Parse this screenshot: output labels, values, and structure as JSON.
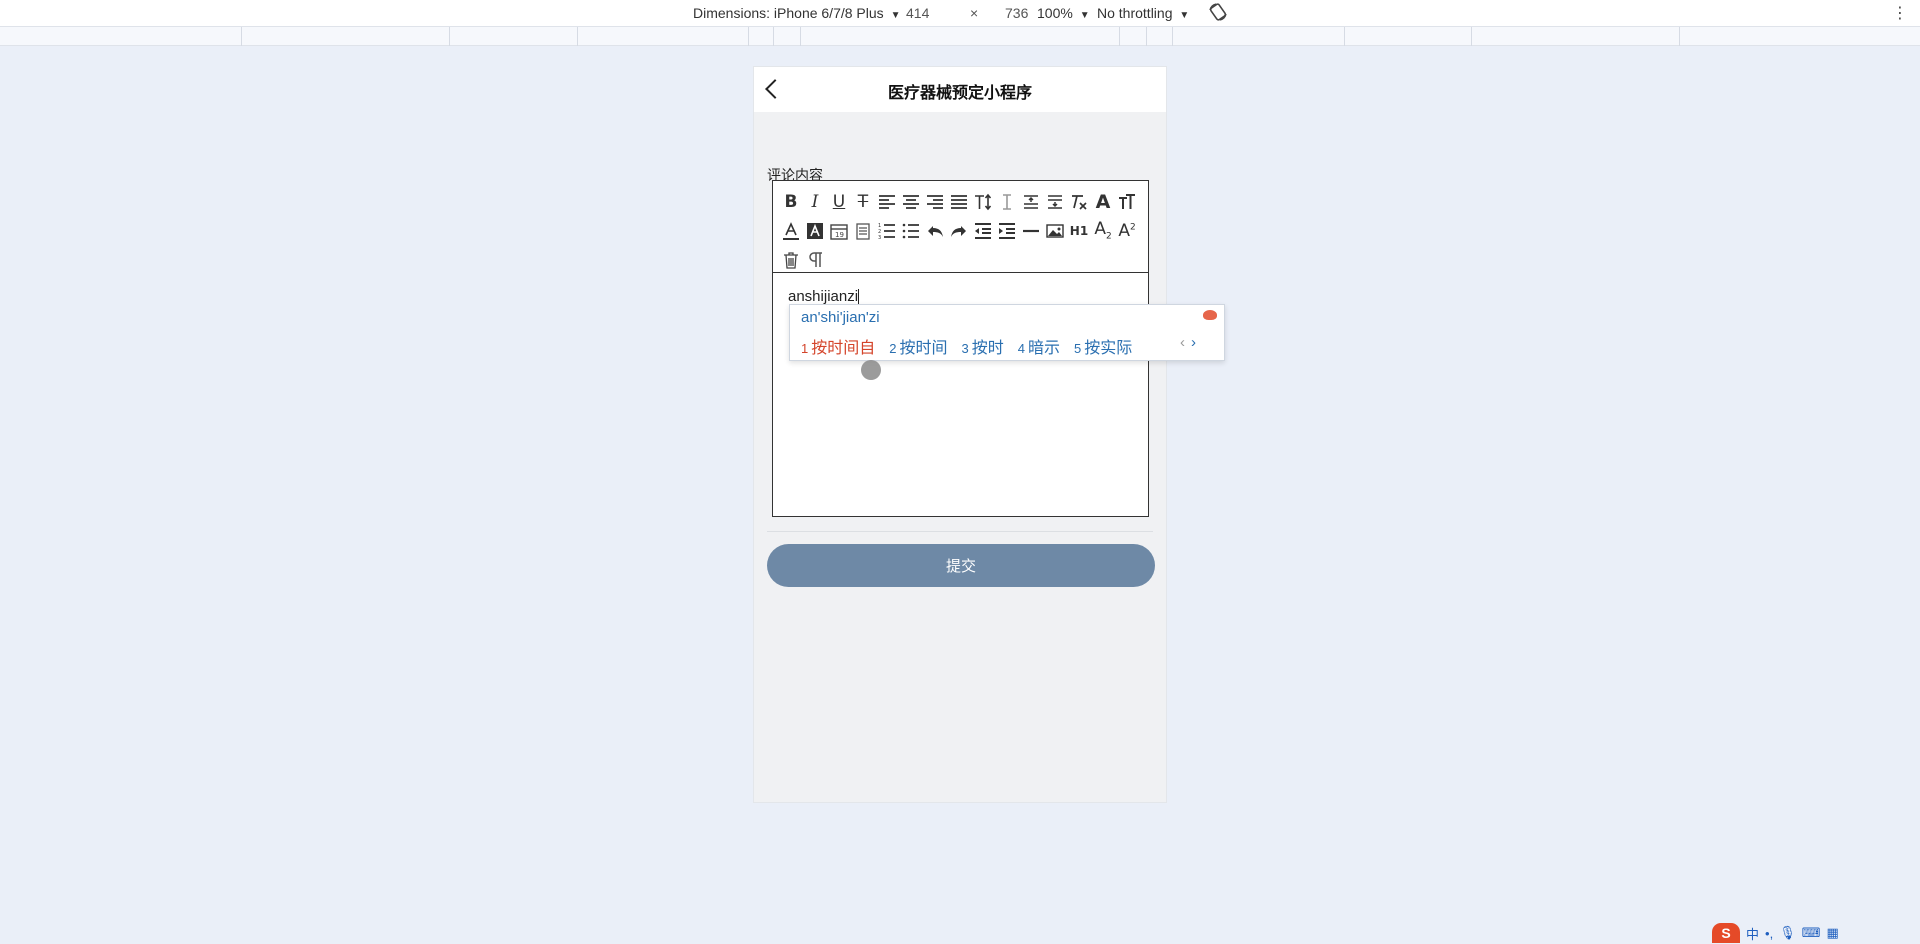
{
  "devtools": {
    "dimensions_label": "Dimensions: iPhone 6/7/8 Plus",
    "width": "414",
    "times": "×",
    "height": "736",
    "zoom": "100%",
    "throttling": "No throttling",
    "caret": "▼",
    "more": "⋮"
  },
  "app": {
    "nav_title": "医疗器械预定小程序",
    "field_label": "评论内容",
    "editor_text": "anshijianzi",
    "submit_label": "提交"
  },
  "toolbar": {
    "row1": [
      "bold-icon",
      "italic-icon",
      "underline-icon",
      "strikethrough-icon",
      "align-left-icon",
      "align-center-icon",
      "align-right-icon",
      "align-justify-icon",
      "line-height-icon",
      "letter-spacing-icon",
      "margin-top-icon",
      "margin-bottom-icon",
      "clear-format-icon",
      "font-size-icon",
      "font-size-alt-icon"
    ],
    "row2": [
      "font-color-icon",
      "background-color-icon",
      "date-icon",
      "checklist-icon",
      "ordered-list-icon",
      "bullet-list-icon",
      "undo-icon",
      "redo-icon",
      "outdent-icon",
      "indent-icon",
      "horizontal-rule-icon",
      "image-icon",
      "heading-h1-icon",
      "subscript-icon",
      "superscript-icon"
    ],
    "row3": [
      "delete-icon",
      "paragraph-icon"
    ]
  },
  "ime": {
    "pinyin": "an'shi'jian'zi",
    "candidates": [
      {
        "num": "1",
        "text": "按时间自"
      },
      {
        "num": "2",
        "text": "按时间"
      },
      {
        "num": "3",
        "text": "按时"
      },
      {
        "num": "4",
        "text": "暗示"
      },
      {
        "num": "5",
        "text": "按实际"
      }
    ],
    "prev": "‹",
    "next": "›"
  },
  "tray": {
    "logo": "S",
    "lang": "中"
  },
  "colors": {
    "page_bg": "#eaeff8",
    "submit_bg": "#6e89a6",
    "ime_first": "#d4442a",
    "ime_text": "#2a6fb0"
  }
}
